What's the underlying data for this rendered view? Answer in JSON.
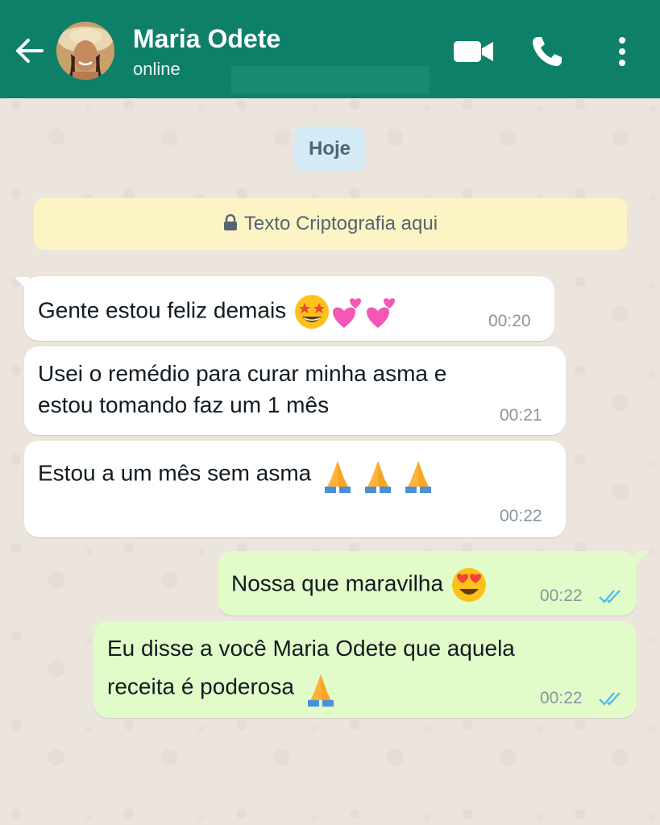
{
  "header": {
    "contact_name": "Maria Odete",
    "status": "online",
    "color": "#0e806a",
    "icons": [
      "back-arrow-icon",
      "video-call-icon",
      "phone-icon",
      "more-vertical-icon"
    ]
  },
  "chat": {
    "date_label": "Hoje",
    "encryption_notice": "Texto Criptografia aqui",
    "messages": [
      {
        "direction": "in",
        "text": "Gente estou feliz demais",
        "emoji": [
          "star-struck",
          "two-hearts",
          "two-hearts"
        ],
        "time": "00:20"
      },
      {
        "direction": "in",
        "lines": [
          "Usei o remédio para curar minha asma e",
          "estou tomando faz um 1 mês"
        ],
        "time": "00:21"
      },
      {
        "direction": "in",
        "text": "Estou a um mês sem asma",
        "emoji": [
          "folded-hands",
          "folded-hands",
          "folded-hands"
        ],
        "time": "00:22"
      },
      {
        "direction": "out",
        "text": "Nossa que maravilha",
        "emoji": [
          "heart-eyes"
        ],
        "time": "00:22",
        "read": true
      },
      {
        "direction": "out",
        "lines": [
          "Eu disse a você Maria Odete que aquela",
          "receita é poderosa"
        ],
        "emoji": [
          "folded-hands"
        ],
        "time": "00:22",
        "read": true
      }
    ]
  },
  "colors": {
    "incoming_bubble": "#ffffff",
    "outgoing_bubble": "#e1fcc8",
    "read_ticks": "#53bdeb",
    "chat_background": "#ece5dd"
  }
}
